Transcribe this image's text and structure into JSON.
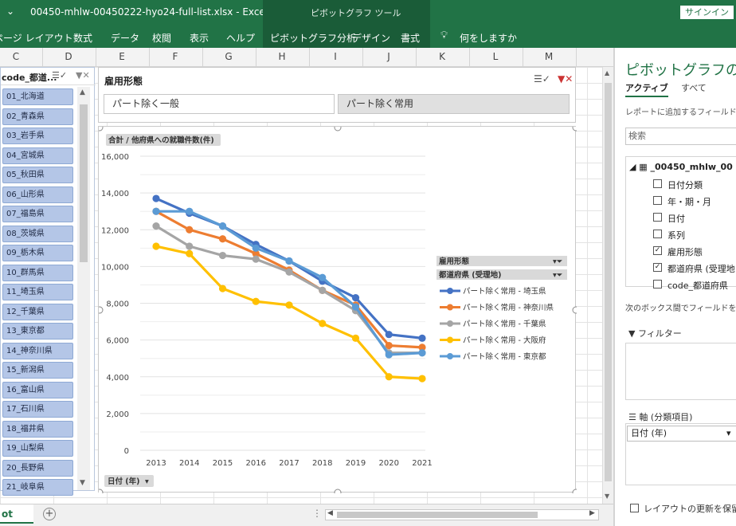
{
  "window": {
    "qat_icon": "⌄",
    "title": "00450-mhlw-00450222-hyo24-full-list.xlsx  -  Excel",
    "tools_context": "ピボットグラフ ツール",
    "signin": "サインイン"
  },
  "ribbon": {
    "tabs": [
      "ページ レイアウト",
      "数式",
      "データ",
      "校閲",
      "表示",
      "ヘルプ",
      "ピボットグラフ分析",
      "デザイン",
      "書式"
    ],
    "tell_me": "何をしますか"
  },
  "columns": [
    "C",
    "D",
    "E",
    "F",
    "G",
    "H",
    "I",
    "J",
    "K",
    "L",
    "M"
  ],
  "slicer_pref": {
    "title": "code_都道...",
    "items": [
      "01_北海道",
      "02_青森県",
      "03_岩手県",
      "04_宮城県",
      "05_秋田県",
      "06_山形県",
      "07_福島県",
      "08_茨城県",
      "09_栃木県",
      "10_群馬県",
      "11_埼玉県",
      "12_千葉県",
      "13_東京都",
      "14_神奈川県",
      "15_新潟県",
      "16_富山県",
      "17_石川県",
      "18_福井県",
      "19_山梨県",
      "20_長野県",
      "21_岐阜県"
    ]
  },
  "slicer_employment": {
    "title": "雇用形態",
    "options": [
      "パート除く一般",
      "パート除く常用"
    ],
    "selected": "パート除く常用"
  },
  "chart": {
    "value_field": "合計 / 他府県への就職件数(件)",
    "axis_field": "日付 (年)",
    "legend_fields": [
      "雇用形態",
      "都道府県 (受理地)"
    ]
  },
  "chart_data": {
    "type": "line",
    "x": [
      "2013",
      "2014",
      "2015",
      "2016",
      "2017",
      "2018",
      "2019",
      "2020",
      "2021"
    ],
    "ylim": [
      0,
      16000
    ],
    "yticks": [
      "0",
      "2,000",
      "4,000",
      "6,000",
      "8,000",
      "10,000",
      "12,000",
      "14,000",
      "16,000"
    ],
    "grid": true,
    "legend_position": "right",
    "series": [
      {
        "name": "パート除く常用 - 埼玉県",
        "color": "#4472c4",
        "values": [
          13700,
          12900,
          12200,
          11200,
          10300,
          9200,
          8300,
          6300,
          6100
        ]
      },
      {
        "name": "パート除く常用 - 神奈川県",
        "color": "#ed7d31",
        "values": [
          13000,
          12000,
          11500,
          10700,
          9800,
          8700,
          7900,
          5700,
          5600
        ]
      },
      {
        "name": "パート除く常用 - 千葉県",
        "color": "#a5a5a5",
        "values": [
          12200,
          11100,
          10600,
          10400,
          9700,
          8700,
          7600,
          5300,
          5300
        ]
      },
      {
        "name": "パート除く常用 - 大阪府",
        "color": "#ffc000",
        "values": [
          11100,
          10700,
          8800,
          8100,
          7900,
          6900,
          6100,
          4000,
          3900
        ]
      },
      {
        "name": "パート除く常用 - 東京都",
        "color": "#5b9bd5",
        "values": [
          13000,
          13000,
          12200,
          11000,
          10300,
          9400,
          7800,
          5200,
          5300
        ]
      }
    ]
  },
  "pane": {
    "title": "ピボットグラフのフィ",
    "tab_active": "アクティブ",
    "tab_all": "すべて",
    "hint": "レポートに追加するフィールドを選",
    "search_placeholder": "検索",
    "root": "_00450_mhlw_00",
    "fields": [
      {
        "label": "日付分類",
        "checked": false
      },
      {
        "label": "年・期・月",
        "checked": false
      },
      {
        "label": "日付",
        "checked": false
      },
      {
        "label": "系列",
        "checked": false
      },
      {
        "label": "雇用形態",
        "checked": true
      },
      {
        "label": "都道府県 (受理地",
        "checked": true
      },
      {
        "label": "code_都道府県",
        "checked": false
      }
    ],
    "drag_hint": "次のボックス間でフィールドをドラ",
    "filter_label": "フィルター",
    "axis_label": "軸 (分類項目)",
    "axis_item": "日付 (年)",
    "defer": "レイアウトの更新を保留す"
  },
  "sheet_tab": "ot"
}
